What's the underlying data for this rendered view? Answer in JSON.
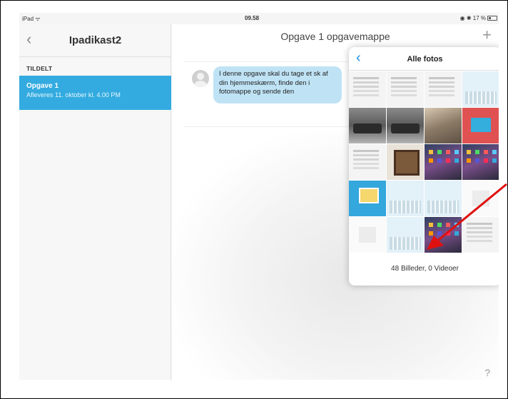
{
  "status_bar": {
    "device": "iPad",
    "time": "09.58",
    "battery": "17 %"
  },
  "sidebar": {
    "title": "Ipadikast2",
    "section_label": "TILDELT",
    "task": {
      "title": "Opgave 1",
      "subtitle": "Afleveres 11. oktober kl. 4.00 PM"
    }
  },
  "main": {
    "title": "Opgave 1 opgavemappe",
    "message": "I denne opgave skal du tage et sk af din hjemmeskærm, finde den i fotomappe og sende den",
    "help": "?"
  },
  "popover": {
    "title": "Alle fotos",
    "count": "48 Billeder, 0 Videoer"
  },
  "colors": {
    "accent": "#33abe0",
    "bubble": "#bfe3f5",
    "annotation": "#e01010"
  }
}
